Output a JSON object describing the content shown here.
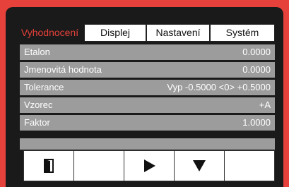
{
  "tabs": [
    {
      "label": "Vyhodnocení",
      "active": true
    },
    {
      "label": "Displej",
      "active": false
    },
    {
      "label": "Nastavení",
      "active": false
    },
    {
      "label": "Systém",
      "active": false
    }
  ],
  "rows": [
    {
      "label": "Etalon",
      "value": "0.0000"
    },
    {
      "label": "Jmenovitá hodnota",
      "value": "0.0000"
    },
    {
      "label": "Tolerance",
      "value": "Vyp -0.5000 <0> +0.5000"
    },
    {
      "label": "Vzorec",
      "value": "+A"
    },
    {
      "label": "Faktor",
      "value": "1.0000"
    }
  ],
  "buttons": [
    {
      "icon": "exit-door-icon"
    },
    {
      "icon": ""
    },
    {
      "icon": "play-icon"
    },
    {
      "icon": "arrow-down-icon"
    },
    {
      "icon": ""
    }
  ],
  "colors": {
    "accent": "#e6413a",
    "screen": "#1a1a1a",
    "row": "#9c9c9c"
  }
}
